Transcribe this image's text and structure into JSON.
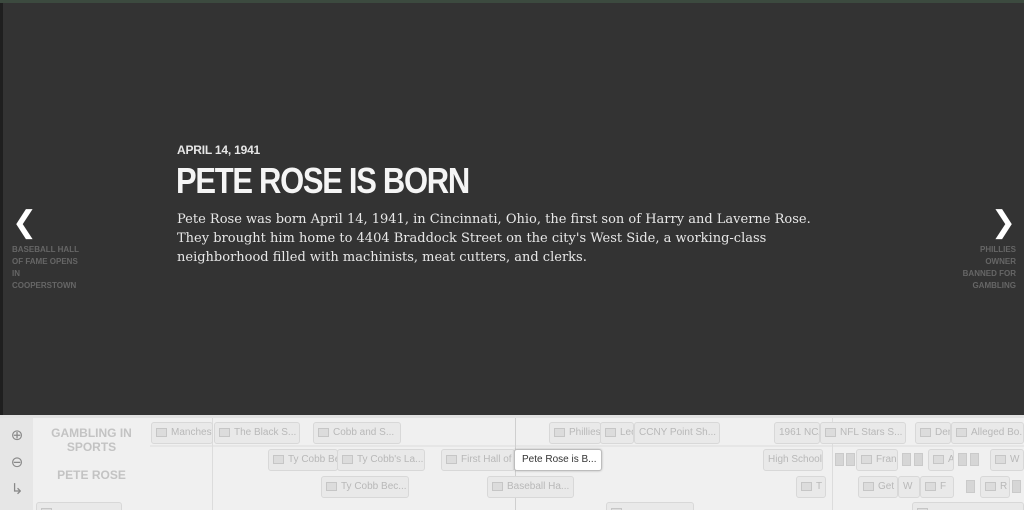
{
  "slide": {
    "date": "APRIL 14, 1941",
    "headline": "PETE ROSE IS BORN",
    "body": "Pete Rose was born April 14, 1941, in Cincinnati, Ohio, the first son of Harry and Laverne Rose. They brought him home to 4404 Braddock Street on the city's West Side, a working-class neighborhood filled with machinists, meat cutters, and clerks."
  },
  "nav": {
    "prev_label": "BASEBALL HALL OF FAME OPENS IN COOPERSTOWN",
    "next_label": "PHILLIES OWNER BANNED FOR GAMBLING"
  },
  "timeline": {
    "groups": [
      "GAMBLING IN SPORTS",
      "PETE ROSE"
    ],
    "markers_row1": [
      "Manchester",
      "The Black S...",
      "Cobb and S...",
      "Phillies",
      "Leo",
      "CCNY Point Sh...",
      "1961 NCAA",
      "NFL Stars S...",
      "Denny",
      "Alleged Bo..."
    ],
    "markers_row2": [
      "Ty Cobb Be...",
      "Ty Cobb's La...",
      "First Hall of",
      "Pete Rose is B...",
      "High School",
      "Frank",
      "Ac",
      "W"
    ],
    "markers_row3": [
      "Ty Cobb Bec...",
      "Baseball Ha...",
      "T",
      "Get",
      "W",
      "F",
      "R"
    ]
  },
  "colors": {
    "slide_bg": "#333333",
    "timeline_bg": "#f0f0f0",
    "active_marker": "#ffffff"
  }
}
